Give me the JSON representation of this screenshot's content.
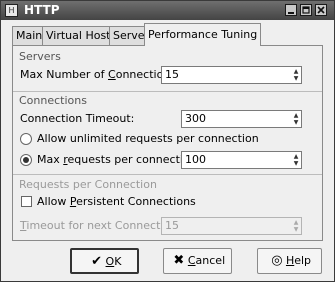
{
  "window": {
    "title": "HTTP",
    "icon_letter": "H"
  },
  "tabs": [
    {
      "label": "Main",
      "active": false
    },
    {
      "label": "Virtual Hosts",
      "active": false
    },
    {
      "label": "Server",
      "active": false
    },
    {
      "label": "Performance Tuning",
      "active": true
    }
  ],
  "servers": {
    "heading": "Servers",
    "max_connections_label_pre": "Max Number of ",
    "max_connections_label_ul": "C",
    "max_connections_label_post": "onnections:",
    "max_connections_value": "15"
  },
  "connections": {
    "heading": "Connections",
    "timeout_label": "Connection Timeout:",
    "timeout_value": "300",
    "unlimited_label": "Allow unlimited requests per connection",
    "unlimited_selected": false,
    "max_requests_label_pre": "Max ",
    "max_requests_label_ul": "r",
    "max_requests_label_post": "equests per connection:",
    "max_requests_selected": true,
    "max_requests_value": "100"
  },
  "requests_per_connection": {
    "heading": "Requests per Connection",
    "persistent_label_pre": "Allow ",
    "persistent_label_ul": "P",
    "persistent_label_post": "ersistent Connections",
    "persistent_checked": false,
    "timeout_next_label_ul": "T",
    "timeout_next_label_post": "imeout for next Connection:",
    "timeout_next_value": "15"
  },
  "buttons": {
    "ok_ul": "O",
    "ok_post": "K",
    "cancel_ul": "C",
    "cancel_post": "ancel",
    "help_ul": "H",
    "help_post": "elp"
  },
  "icons": {
    "ok": "checkmark-icon",
    "cancel": "cancel-x-icon",
    "help": "help-lifebuoy-icon"
  }
}
